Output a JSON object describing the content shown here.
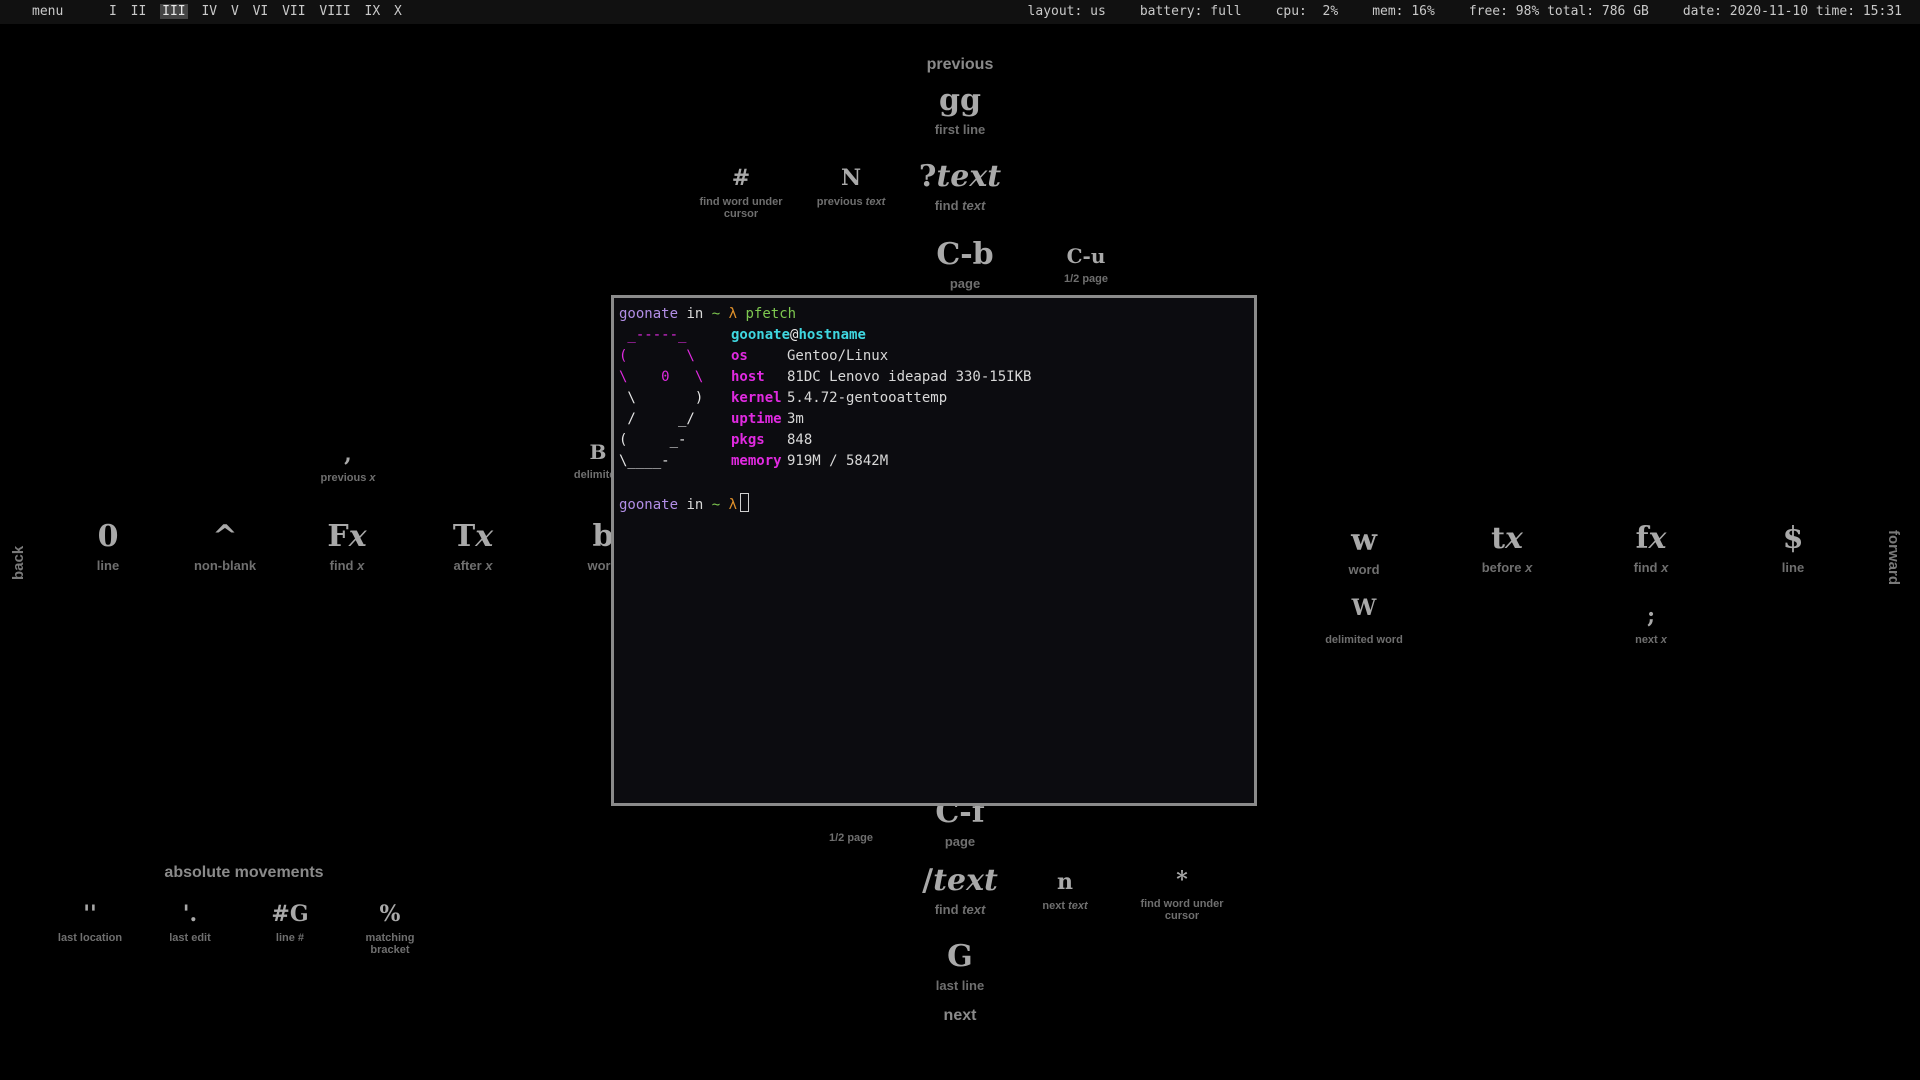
{
  "topbar": {
    "menu": "menu",
    "workspaces": [
      "I",
      "II",
      "III",
      "IV",
      "V",
      "VI",
      "VII",
      "VIII",
      "IX",
      "X"
    ],
    "active_workspace": "III",
    "layout": "layout: us",
    "battery": "battery: full",
    "cpu": "cpu:  2%",
    "mem": "mem: 16%",
    "disk": "free: 98% total: 786 GB",
    "datetime": "date: 2020-11-10 time: 15:31"
  },
  "wallpaper": {
    "previous_label": "previous",
    "next_label": "next",
    "back_label": "back",
    "forward_label": "forward",
    "absolute_heading": "absolute movements",
    "gg": {
      "key": "gg",
      "desc": "first line"
    },
    "hash": {
      "key": "#",
      "desc": "find word under cursor"
    },
    "N": {
      "key": "N",
      "desc": "previous",
      "desc_em": "text"
    },
    "qtext": {
      "key": "?",
      "key_em": "text",
      "desc": "find",
      "desc_em": "text"
    },
    "Cb": {
      "key": "C-b",
      "desc": "page"
    },
    "Cu": {
      "key": "C-u",
      "desc": "1/2 page"
    },
    "comma": {
      "key": ",",
      "desc": "previous",
      "desc_em": "x"
    },
    "B": {
      "key": "B",
      "desc": "delimited"
    },
    "zero": {
      "key": "0",
      "desc": "line"
    },
    "caret": {
      "key": "^",
      "desc": "non-blank"
    },
    "Fx": {
      "key": "F",
      "key_em": "x",
      "desc": "find",
      "desc_em": "x"
    },
    "Tx": {
      "key": "T",
      "key_em": "x",
      "desc": "after",
      "desc_em": "x"
    },
    "b": {
      "key": "b",
      "desc": "word"
    },
    "w": {
      "key": "w",
      "desc": "word"
    },
    "tx": {
      "key": "t",
      "key_em": "x",
      "desc": "before",
      "desc_em": "x"
    },
    "fx": {
      "key": "f",
      "key_em": "x",
      "desc": "find",
      "desc_em": "x"
    },
    "dollar": {
      "key": "$",
      "desc": "line"
    },
    "W": {
      "key": "W",
      "desc": "delimited word"
    },
    "semicolon": {
      "key": ";",
      "desc": "next",
      "desc_em": "x"
    },
    "Cd_desc": "1/2 page",
    "Cf": {
      "key": "C-f",
      "desc": "page"
    },
    "stext": {
      "key": "/",
      "key_em": "text",
      "desc": "find",
      "desc_em": "text"
    },
    "n": {
      "key": "n",
      "desc": "next",
      "desc_em": "text"
    },
    "star": {
      "key": "*",
      "desc": "find word under cursor"
    },
    "G": {
      "key": "G",
      "desc": "last line"
    },
    "ticks": {
      "key": "''",
      "desc": "last location"
    },
    "tickdot": {
      "key": "'.",
      "desc": "last edit"
    },
    "numG": {
      "key": "#G",
      "desc": "line #"
    },
    "percent": {
      "key": "%",
      "desc": "matching bracket"
    }
  },
  "terminal": {
    "prompt_user": "goonate",
    "prompt_in": "in",
    "prompt_dir": "~",
    "prompt_lambda": "λ",
    "command": "pfetch",
    "user": "goonate",
    "at": "@",
    "host": "hostname",
    "art": [
      " _-----_",
      "(       \\",
      "\\    0   \\",
      " \\       )",
      " /     _/",
      "(     _-",
      "\\____-"
    ],
    "info": [
      {
        "key": "os",
        "value": "Gentoo/Linux"
      },
      {
        "key": "host",
        "value": "81DC Lenovo ideapad 330-15IKB"
      },
      {
        "key": "kernel",
        "value": "5.4.72-gentooattemp"
      },
      {
        "key": "uptime",
        "value": "3m"
      },
      {
        "key": "pkgs",
        "value": "848"
      },
      {
        "key": "memory",
        "value": "919M / 5842M"
      }
    ]
  }
}
